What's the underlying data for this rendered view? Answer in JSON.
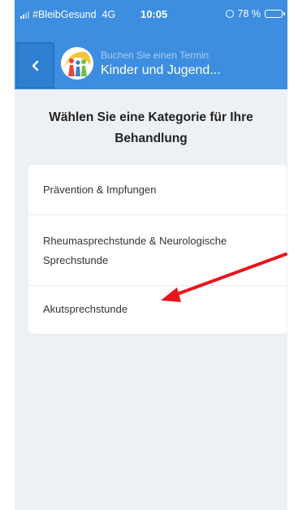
{
  "status_bar": {
    "carrier": "#BleibGesund",
    "network": "4G",
    "time": "10:05",
    "battery_text": "78 %",
    "battery_level": 0.78
  },
  "nav": {
    "back_icon": "chevron-left-icon",
    "subtitle": "Buchen Sie einen Termin",
    "title": "Kinder und Jugend..."
  },
  "page": {
    "heading": "Wählen Sie eine Kategorie für Ihre Behandlung"
  },
  "categories": [
    {
      "label": "Prävention & Impfungen"
    },
    {
      "label": "Rheumasprechstunde & Neurologische Sprechstunde"
    },
    {
      "label": "Akutsprechstunde"
    }
  ],
  "colors": {
    "header_blue": "#3d8ee0",
    "background": "#eef1f4",
    "annotation_arrow": "#e8141b"
  }
}
